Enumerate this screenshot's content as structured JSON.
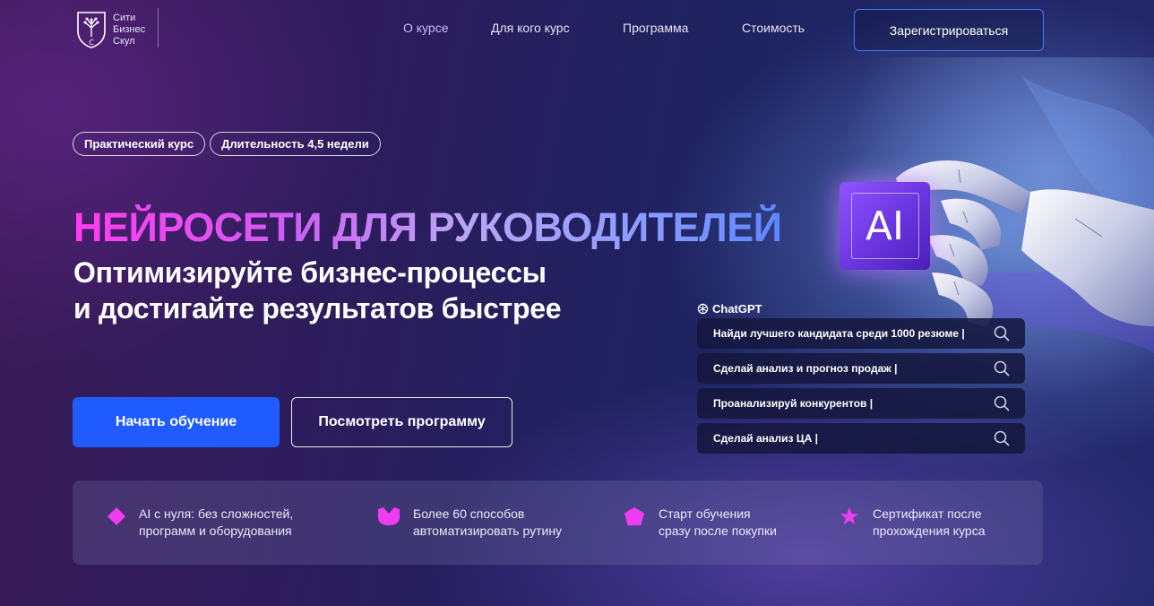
{
  "brand": {
    "logo_lines": [
      "Сити",
      "Бизнес",
      "Скул"
    ],
    "logo_letter": "С"
  },
  "nav": {
    "items": [
      "О курсе",
      "Для кого курс",
      "Программа",
      "Стоимость"
    ],
    "register": "Зарегистрироваться"
  },
  "hero": {
    "tags": [
      "Практический курс",
      "Длительность 4,5 недели"
    ],
    "title": "НЕЙРОСЕТИ ДЛЯ РУКОВОДИТЕЛЕЙ",
    "subtitle_line1": "Оптимизируйте бизнес-процессы",
    "subtitle_line2": "и достигайте результатов быстрее",
    "primary_button": "Начать обучение",
    "secondary_button": "Посмотреть программу"
  },
  "visual": {
    "chip_label": "AI",
    "chatgpt_label": "ChatGPT",
    "prompts": [
      "Найди лучшего кандидата среди 1000 резюме |",
      "Сделай анализ и прогноз продаж |",
      "Проанализируй конкурентов |",
      "Сделай  анализ ЦА |"
    ]
  },
  "features": [
    {
      "line1": "AI с нуля: без сложностей,",
      "line2": "программ и оборудования",
      "icon": "diamond-icon"
    },
    {
      "line1": "Более 60 способов",
      "line2": "автоматизировать рутину",
      "icon": "bowl-icon"
    },
    {
      "line1": "Старт обучения",
      "line2": "сразу после покупки",
      "icon": "pentagon-icon"
    },
    {
      "line1": "Сертификат после",
      "line2": "прохождения курса",
      "icon": "star-icon"
    }
  ],
  "colors": {
    "accent_blue": "#1f5bff",
    "feature_icon": "#f03cf0",
    "title_gradient_start": "#ff3cf0",
    "title_gradient_end": "#5d86ff"
  }
}
